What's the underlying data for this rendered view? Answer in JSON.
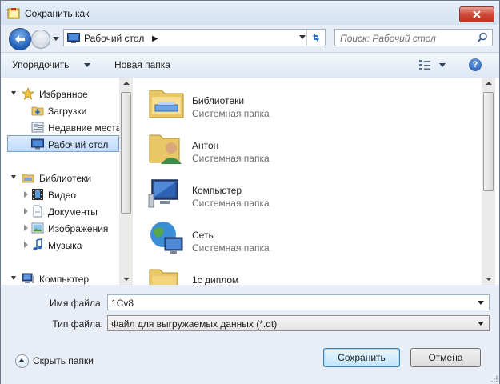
{
  "window": {
    "title": "Сохранить как"
  },
  "nav": {
    "address_path": "Рабочий стол",
    "search_placeholder": "Поиск: Рабочий стол"
  },
  "toolbar": {
    "organize_label": "Упорядочить",
    "new_folder_label": "Новая папка",
    "help_label": "?"
  },
  "nav_pane": {
    "items": [
      {
        "label": "Избранное",
        "icon": "star-icon"
      },
      {
        "label": "Загрузки",
        "icon": "downloads-folder-icon"
      },
      {
        "label": "Недавние места",
        "icon": "recent-places-icon"
      },
      {
        "label": "Рабочий стол",
        "icon": "desktop-icon",
        "selected": true
      },
      {
        "label": "Библиотеки",
        "icon": "libraries-icon"
      },
      {
        "label": "Видео",
        "icon": "video-icon"
      },
      {
        "label": "Документы",
        "icon": "documents-icon"
      },
      {
        "label": "Изображения",
        "icon": "pictures-icon"
      },
      {
        "label": "Музыка",
        "icon": "music-icon"
      },
      {
        "label": "Компьютер",
        "icon": "computer-icon"
      }
    ]
  },
  "files": [
    {
      "name": "Библиотеки",
      "type": "Системная папка",
      "icon": "libraries-folder-icon"
    },
    {
      "name": "Антон",
      "type": "Системная папка",
      "icon": "user-folder-icon"
    },
    {
      "name": "Компьютер",
      "type": "Системная папка",
      "icon": "computer-icon"
    },
    {
      "name": "Сеть",
      "type": "Системная папка",
      "icon": "network-icon"
    },
    {
      "name": "1с диплом",
      "type": "",
      "icon": "folder-icon"
    }
  ],
  "form": {
    "filename_label": "Имя файла:",
    "filename_value": "1Cv8",
    "filetype_label": "Тип файла:",
    "filetype_value": "Файл для выгружаемых данных (*.dt)"
  },
  "footer": {
    "hide_folders_label": "Скрыть папки",
    "save_label": "Сохранить",
    "cancel_label": "Отмена"
  }
}
